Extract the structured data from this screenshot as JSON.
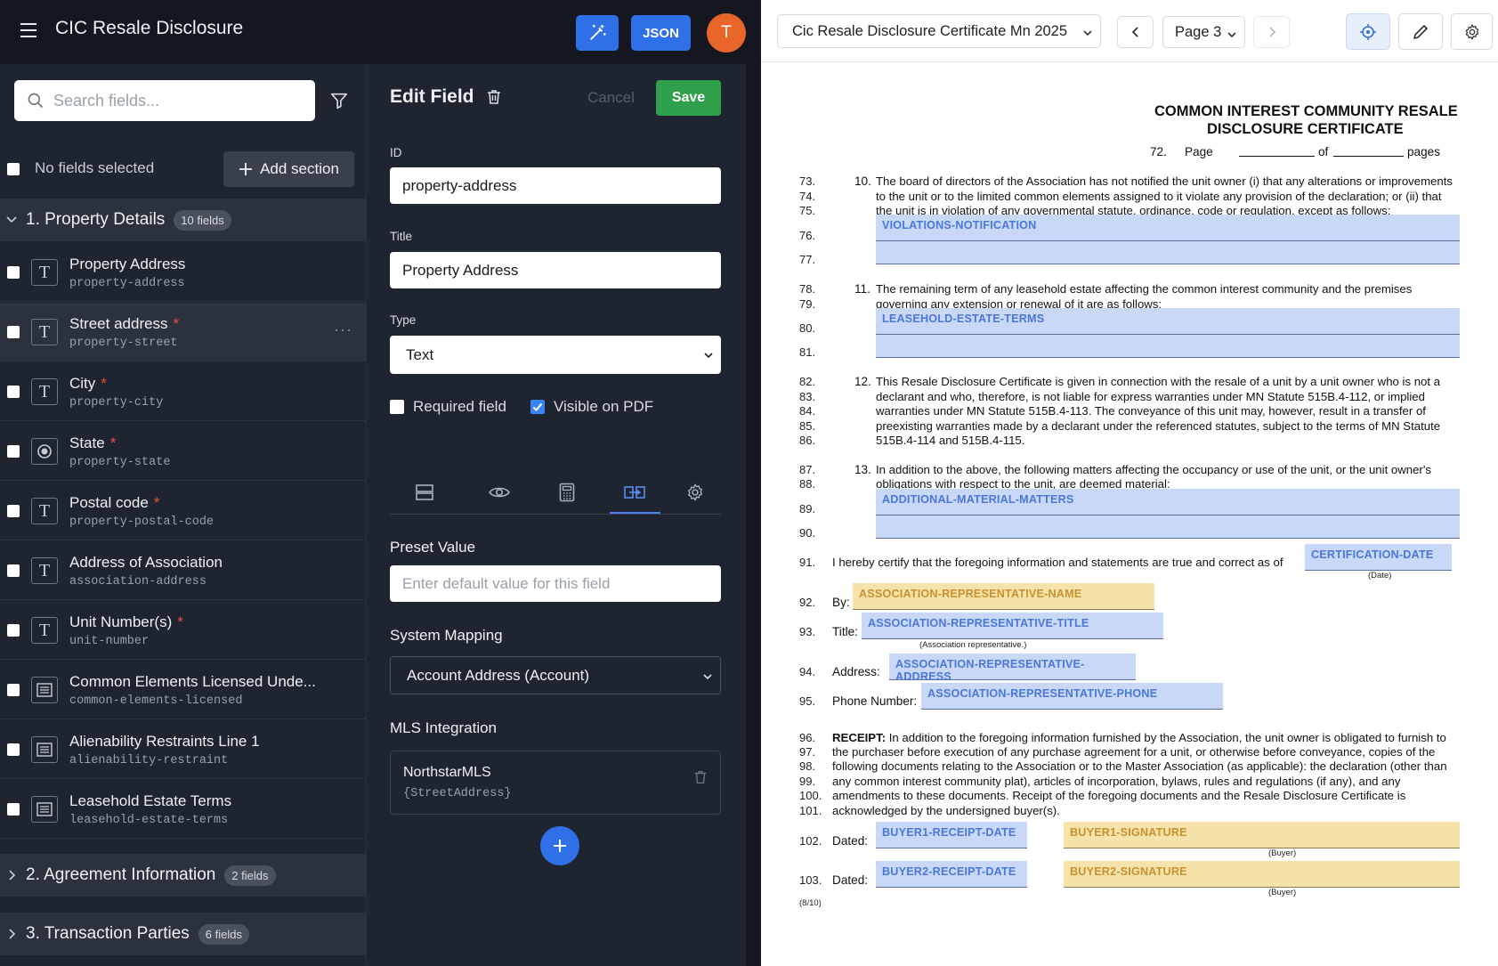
{
  "app": {
    "title": "CIC Resale Disclosure",
    "json_label": "JSON",
    "avatar_initial": "T"
  },
  "search": {
    "placeholder": "Search fields..."
  },
  "selection": {
    "status": "No fields selected",
    "add_section_label": "Add section"
  },
  "sections": [
    {
      "title": "1. Property Details",
      "badge": "10 fields"
    },
    {
      "title": "2. Agreement Information",
      "badge": "2 fields"
    },
    {
      "title": "3. Transaction Parties",
      "badge": "6 fields"
    }
  ],
  "fields": [
    {
      "name": "Property Address",
      "id": "property-address",
      "required": "",
      "icon": "text-icon"
    },
    {
      "name": "Street address",
      "id": "property-street",
      "required": "*",
      "icon": "text-icon"
    },
    {
      "name": "City",
      "id": "property-city",
      "required": "*",
      "icon": "text-icon"
    },
    {
      "name": "State",
      "id": "property-state",
      "required": "*",
      "icon": "radio-icon"
    },
    {
      "name": "Postal code",
      "id": "property-postal-code",
      "required": "*",
      "icon": "text-icon"
    },
    {
      "name": "Address of Association",
      "id": "association-address",
      "required": "",
      "icon": "text-icon"
    },
    {
      "name": "Unit Number(s)",
      "id": "unit-number",
      "required": "*",
      "icon": "text-icon"
    },
    {
      "name": "Common Elements Licensed Unde...",
      "id": "common-elements-licensed",
      "required": "",
      "icon": "textarea-icon"
    },
    {
      "name": "Alienability Restraints Line 1",
      "id": "alienability-restraint",
      "required": "",
      "icon": "textarea-icon"
    },
    {
      "name": "Leasehold Estate Terms",
      "id": "leasehold-estate-terms",
      "required": "",
      "icon": "textarea-icon"
    }
  ],
  "edit": {
    "title": "Edit Field",
    "cancel_label": "Cancel",
    "save_label": "Save",
    "id_label": "ID",
    "id_value": "property-address",
    "title_label": "Title",
    "title_value": "Property Address",
    "type_label": "Type",
    "type_value": "Text",
    "required_label": "Required field",
    "visible_label": "Visible on PDF",
    "preset_label": "Preset Value",
    "preset_placeholder": "Enter default value for this field",
    "mapping_label": "System Mapping",
    "mapping_value": "Account Address (Account)",
    "mls_label": "MLS Integration",
    "mls_name": "NorthstarMLS",
    "mls_value": "{StreetAddress}"
  },
  "viewer": {
    "document": "Cic Resale Disclosure Certificate Mn 2025",
    "page": "Page 3"
  },
  "doc": {
    "heading1": "COMMON INTEREST COMMUNITY RESALE",
    "heading2": "DISCLOSURE CERTIFICATE",
    "page_line": {
      "num": "72.",
      "page": "Page",
      "of": "of",
      "pages": "pages"
    },
    "lines": {
      "l73": "73.",
      "l74": "74.",
      "l75": "75.",
      "l76": "76.",
      "l77": "77.",
      "l78": "78.",
      "l79": "79.",
      "l80": "80.",
      "l81": "81.",
      "l82": "82.",
      "l83": "83.",
      "l84": "84.",
      "l85": "85.",
      "l86": "86.",
      "l87": "87.",
      "l88": "88.",
      "l89": "89.",
      "l90": "90.",
      "l91": "91.",
      "l92": "92.",
      "l93": "93.",
      "l94": "94.",
      "l95": "95.",
      "l96": "96.",
      "l97": "97.",
      "l98": "98.",
      "l99": "99.",
      "l100": "100.",
      "l101": "101.",
      "l102": "102.",
      "l103": "103."
    },
    "p10": [
      "10.",
      "The board of directors of the Association has not notified the unit owner (i) that any alterations or improvements",
      "to the unit or to the limited common elements assigned to it violate any provision of the declaration; or (ii) that",
      "the unit is in violation of any governmental statute, ordinance, code or regulation, except as follows:"
    ],
    "p11": [
      "11.",
      "The remaining term of any leasehold estate affecting the common interest community and the premises",
      "governing any extension or renewal of it are as follows:"
    ],
    "p12": [
      "12.",
      "This Resale Disclosure Certificate is given in connection with the resale of a unit by a unit owner who is not a",
      "declarant and who, therefore, is not liable for express warranties under MN Statute 515B.4-112, or implied",
      "warranties under MN Statute 515B.4-113. The conveyance of this unit may, however, result in a transfer of",
      "preexisting warranties made by a declarant under the referenced statutes, subject to the terms of MN Statute",
      "515B.4-114 and 515B.4-115."
    ],
    "p13": [
      "13.",
      "In addition to the above, the following matters affecting the occupancy or use of the unit, or the unit owner's",
      "obligations with respect to the unit, are deemed material:"
    ],
    "certify": "I hereby certify that the foregoing information and statements are true and correct as of",
    "date_note": "(Date)",
    "by": "By:",
    "title": "Title:",
    "assoc_rep_note": "(Association representative.)",
    "address": "Address:",
    "phone": "Phone Number:",
    "receipt_bold": "RECEIPT:",
    "receipt": [
      "In addition to the foregoing information furnished by the Association, the unit owner is obligated to furnish to",
      "the purchaser before execution of any purchase agreement for a unit, or otherwise before conveyance, copies of the",
      "following documents relating to the Association or to the Master Association (as applicable): the declaration (other than",
      "any common interest community plat), articles of incorporation, bylaws, rules and regulations (if any), and any",
      "amendments to these documents. Receipt of the foregoing documents and the Resale Disclosure Certificate is",
      "acknowledged by the undersigned buyer(s)."
    ],
    "dated": "Dated:",
    "buyer_note": "(Buyer)",
    "footer": "(8/10)",
    "fields": {
      "violations": "VIOLATIONS-NOTIFICATION",
      "leasehold": "LEASEHOLD-ESTATE-TERMS",
      "material": "ADDITIONAL-MATERIAL-MATTERS",
      "cert_date": "CERTIFICATION-DATE",
      "rep_name": "ASSOCIATION-REPRESENTATIVE-NAME",
      "rep_title": "ASSOCIATION-REPRESENTATIVE-TITLE",
      "rep_address": "ASSOCIATION-REPRESENTATIVE-ADDRESS",
      "rep_phone": "ASSOCIATION-REPRESENTATIVE-PHONE",
      "b1_date": "BUYER1-RECEIPT-DATE",
      "b1_sig": "BUYER1-SIGNATURE",
      "b2_date": "BUYER2-RECEIPT-DATE",
      "b2_sig": "BUYER2-SIGNATURE"
    }
  },
  "colors": {
    "accent": "#2f6fe8",
    "save": "#2ea04b",
    "avatar": "#e9662b",
    "field_blue": "#c9d8f7",
    "field_yellow": "#f6e3a9"
  }
}
